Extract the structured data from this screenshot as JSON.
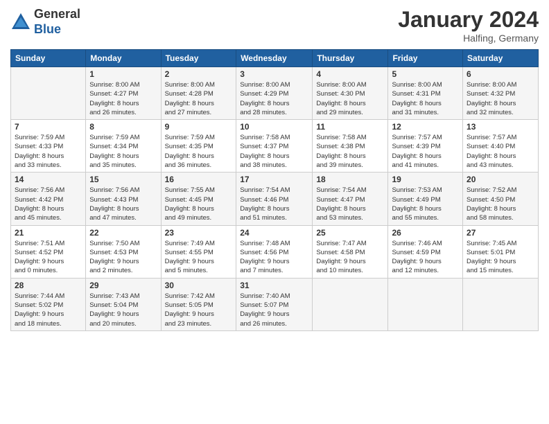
{
  "header": {
    "logo_general": "General",
    "logo_blue": "Blue",
    "month_title": "January 2024",
    "location": "Halfing, Germany"
  },
  "weekdays": [
    "Sunday",
    "Monday",
    "Tuesday",
    "Wednesday",
    "Thursday",
    "Friday",
    "Saturday"
  ],
  "weeks": [
    [
      {
        "day": "",
        "info": ""
      },
      {
        "day": "1",
        "info": "Sunrise: 8:00 AM\nSunset: 4:27 PM\nDaylight: 8 hours\nand 26 minutes."
      },
      {
        "day": "2",
        "info": "Sunrise: 8:00 AM\nSunset: 4:28 PM\nDaylight: 8 hours\nand 27 minutes."
      },
      {
        "day": "3",
        "info": "Sunrise: 8:00 AM\nSunset: 4:29 PM\nDaylight: 8 hours\nand 28 minutes."
      },
      {
        "day": "4",
        "info": "Sunrise: 8:00 AM\nSunset: 4:30 PM\nDaylight: 8 hours\nand 29 minutes."
      },
      {
        "day": "5",
        "info": "Sunrise: 8:00 AM\nSunset: 4:31 PM\nDaylight: 8 hours\nand 31 minutes."
      },
      {
        "day": "6",
        "info": "Sunrise: 8:00 AM\nSunset: 4:32 PM\nDaylight: 8 hours\nand 32 minutes."
      }
    ],
    [
      {
        "day": "7",
        "info": "Sunrise: 7:59 AM\nSunset: 4:33 PM\nDaylight: 8 hours\nand 33 minutes."
      },
      {
        "day": "8",
        "info": "Sunrise: 7:59 AM\nSunset: 4:34 PM\nDaylight: 8 hours\nand 35 minutes."
      },
      {
        "day": "9",
        "info": "Sunrise: 7:59 AM\nSunset: 4:35 PM\nDaylight: 8 hours\nand 36 minutes."
      },
      {
        "day": "10",
        "info": "Sunrise: 7:58 AM\nSunset: 4:37 PM\nDaylight: 8 hours\nand 38 minutes."
      },
      {
        "day": "11",
        "info": "Sunrise: 7:58 AM\nSunset: 4:38 PM\nDaylight: 8 hours\nand 39 minutes."
      },
      {
        "day": "12",
        "info": "Sunrise: 7:57 AM\nSunset: 4:39 PM\nDaylight: 8 hours\nand 41 minutes."
      },
      {
        "day": "13",
        "info": "Sunrise: 7:57 AM\nSunset: 4:40 PM\nDaylight: 8 hours\nand 43 minutes."
      }
    ],
    [
      {
        "day": "14",
        "info": "Sunrise: 7:56 AM\nSunset: 4:42 PM\nDaylight: 8 hours\nand 45 minutes."
      },
      {
        "day": "15",
        "info": "Sunrise: 7:56 AM\nSunset: 4:43 PM\nDaylight: 8 hours\nand 47 minutes."
      },
      {
        "day": "16",
        "info": "Sunrise: 7:55 AM\nSunset: 4:45 PM\nDaylight: 8 hours\nand 49 minutes."
      },
      {
        "day": "17",
        "info": "Sunrise: 7:54 AM\nSunset: 4:46 PM\nDaylight: 8 hours\nand 51 minutes."
      },
      {
        "day": "18",
        "info": "Sunrise: 7:54 AM\nSunset: 4:47 PM\nDaylight: 8 hours\nand 53 minutes."
      },
      {
        "day": "19",
        "info": "Sunrise: 7:53 AM\nSunset: 4:49 PM\nDaylight: 8 hours\nand 55 minutes."
      },
      {
        "day": "20",
        "info": "Sunrise: 7:52 AM\nSunset: 4:50 PM\nDaylight: 8 hours\nand 58 minutes."
      }
    ],
    [
      {
        "day": "21",
        "info": "Sunrise: 7:51 AM\nSunset: 4:52 PM\nDaylight: 9 hours\nand 0 minutes."
      },
      {
        "day": "22",
        "info": "Sunrise: 7:50 AM\nSunset: 4:53 PM\nDaylight: 9 hours\nand 2 minutes."
      },
      {
        "day": "23",
        "info": "Sunrise: 7:49 AM\nSunset: 4:55 PM\nDaylight: 9 hours\nand 5 minutes."
      },
      {
        "day": "24",
        "info": "Sunrise: 7:48 AM\nSunset: 4:56 PM\nDaylight: 9 hours\nand 7 minutes."
      },
      {
        "day": "25",
        "info": "Sunrise: 7:47 AM\nSunset: 4:58 PM\nDaylight: 9 hours\nand 10 minutes."
      },
      {
        "day": "26",
        "info": "Sunrise: 7:46 AM\nSunset: 4:59 PM\nDaylight: 9 hours\nand 12 minutes."
      },
      {
        "day": "27",
        "info": "Sunrise: 7:45 AM\nSunset: 5:01 PM\nDaylight: 9 hours\nand 15 minutes."
      }
    ],
    [
      {
        "day": "28",
        "info": "Sunrise: 7:44 AM\nSunset: 5:02 PM\nDaylight: 9 hours\nand 18 minutes."
      },
      {
        "day": "29",
        "info": "Sunrise: 7:43 AM\nSunset: 5:04 PM\nDaylight: 9 hours\nand 20 minutes."
      },
      {
        "day": "30",
        "info": "Sunrise: 7:42 AM\nSunset: 5:05 PM\nDaylight: 9 hours\nand 23 minutes."
      },
      {
        "day": "31",
        "info": "Sunrise: 7:40 AM\nSunset: 5:07 PM\nDaylight: 9 hours\nand 26 minutes."
      },
      {
        "day": "",
        "info": ""
      },
      {
        "day": "",
        "info": ""
      },
      {
        "day": "",
        "info": ""
      }
    ]
  ]
}
